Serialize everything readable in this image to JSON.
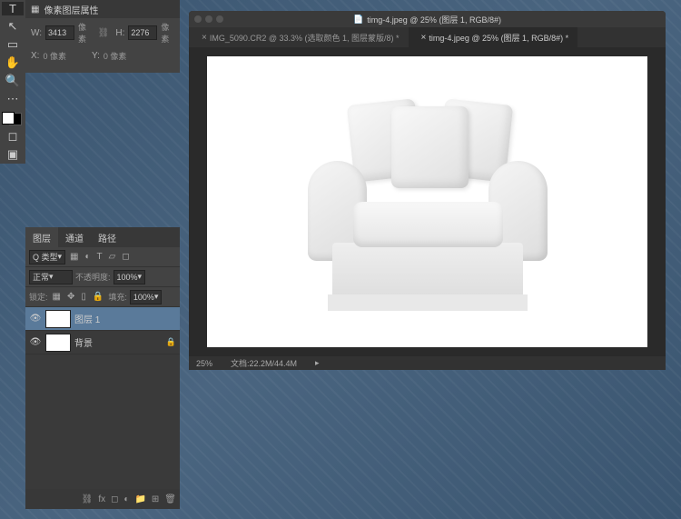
{
  "properties": {
    "title": "像素图层属性",
    "w_label": "W:",
    "w_value": "3413",
    "w_unit": "像素",
    "h_label": "H:",
    "h_value": "2276",
    "h_unit": "像素",
    "x_label": "X:",
    "x_value": "0 像素",
    "y_label": "Y:",
    "y_value": "0 像素"
  },
  "layers": {
    "tabs": [
      "图层",
      "通道",
      "路径"
    ],
    "kind_label": "Q 类型",
    "blend": "正常",
    "opacity_label": "不透明度:",
    "opacity_val": "100%",
    "lock_label": "锁定:",
    "fill_label": "填充:",
    "fill_val": "100%",
    "items": [
      {
        "name": "图层 1"
      },
      {
        "name": "背景"
      }
    ]
  },
  "window": {
    "title": "timg-4.jpeg @ 25% (图层 1, RGB/8#)",
    "tabs": [
      "IMG_5090.CR2 @ 33.3% (选取颜色 1, 图层蒙版/8) *",
      "timg-4.jpeg @ 25% (图层 1, RGB/8#) *"
    ]
  },
  "status": {
    "zoom": "25%",
    "doc": "文档:22.2M/44.4M"
  }
}
